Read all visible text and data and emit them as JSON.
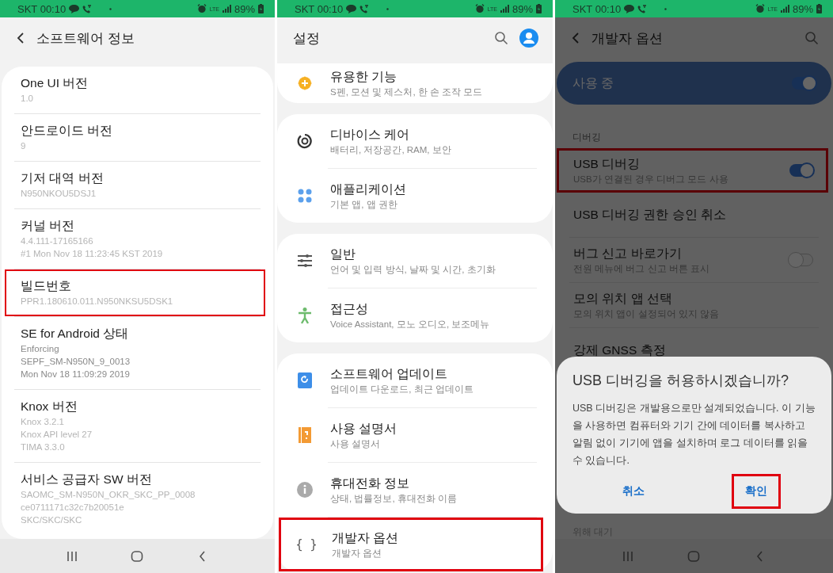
{
  "software_info": {
    "status_bar": {
      "carrier_time": "SKT 00:10",
      "network": "LTE",
      "battery": "89%"
    },
    "header": {
      "title": "소프트웨어 정보"
    },
    "items": [
      {
        "title": "One UI 버전",
        "lines": [
          "1.0"
        ],
        "blurred": true,
        "highlighted": false
      },
      {
        "title": "안드로이드 버전",
        "lines": [
          "9"
        ],
        "blurred": true,
        "highlighted": false
      },
      {
        "title": "기저 대역 버전",
        "lines": [
          "N950NKOU5DSJ1"
        ],
        "blurred": true,
        "highlighted": false
      },
      {
        "title": "커널 버전",
        "lines": [
          "4.4.111-17165166",
          "#1 Mon Nov 18 11:23:45 KST 2019"
        ],
        "blurred": true,
        "highlighted": false
      },
      {
        "title": "빌드번호",
        "lines": [
          "PPR1.180610.011.N950NKSU5DSK1"
        ],
        "blurred": true,
        "highlighted": true
      },
      {
        "title": "SE for Android 상태",
        "lines": [
          "Enforcing",
          "SEPF_SM-N950N_9_0013",
          "Mon Nov 18 11:09:29 2019"
        ],
        "blurred": false,
        "highlighted": false
      },
      {
        "title": "Knox 버전",
        "lines": [
          "Knox 3.2.1",
          "Knox API level 27",
          "TIMA 3.3.0"
        ],
        "blurred": true,
        "highlighted": false
      },
      {
        "title": "서비스 공급자 SW 버전",
        "lines": [
          "SAOMC_SM-N950N_OKR_SKC_PP_0008",
          "ce0711171c32c7b20051e",
          "SKC/SKC/SKC"
        ],
        "blurred": true,
        "highlighted": false
      }
    ]
  },
  "settings": {
    "status_bar": {
      "carrier_time": "SKT 00:10",
      "network": "LTE",
      "battery": "89%"
    },
    "header": {
      "title": "설정"
    },
    "cards": [
      {
        "items": [
          {
            "title": "유용한 기능",
            "subtitle": "S펜, 모션 및 제스처, 한 손 조작 모드",
            "highlighted": false
          }
        ]
      },
      {
        "items": [
          {
            "title": "디바이스 케어",
            "subtitle": "배터리, 저장공간, RAM, 보안",
            "highlighted": false
          },
          {
            "title": "애플리케이션",
            "subtitle": "기본 앱, 앱 권한",
            "highlighted": false
          }
        ]
      },
      {
        "items": [
          {
            "title": "일반",
            "subtitle": "언어 및 입력 방식, 날짜 및 시간, 초기화",
            "highlighted": false
          },
          {
            "title": "접근성",
            "subtitle": "Voice Assistant, 모노 오디오, 보조메뉴",
            "highlighted": false
          }
        ]
      },
      {
        "items": [
          {
            "title": "소프트웨어 업데이트",
            "subtitle": "업데이트 다운로드, 최근 업데이트",
            "highlighted": false
          },
          {
            "title": "사용 설명서",
            "subtitle": "사용 설명서",
            "highlighted": false
          },
          {
            "title": "휴대전화 정보",
            "subtitle": "상태, 법률정보, 휴대전화 이름",
            "highlighted": false
          },
          {
            "title": "개발자 옵션",
            "subtitle": "개발자 옵션",
            "glyph": "{ }",
            "highlighted": true
          }
        ]
      }
    ]
  },
  "developer_options": {
    "status_bar": {
      "carrier_time": "SKT 00:10",
      "network": "LTE",
      "battery": "89%"
    },
    "header": {
      "title": "개발자 옵션"
    },
    "master_switch": {
      "label": "사용 중",
      "on": true
    },
    "section": "디버깅",
    "items": [
      {
        "kind": "toggle",
        "title": "USB 디버깅",
        "subtitle": "USB가 연결된 경우 디버그 모드 사용",
        "on": true,
        "highlighted": true
      },
      {
        "kind": "plain",
        "title": "USB 디버깅 권한 승인 취소",
        "highlighted": false
      },
      {
        "kind": "toggle",
        "title": "버그 신고 바로가기",
        "subtitle": "전원 메뉴에 버그 신고 버튼 표시",
        "on": false,
        "highlighted": false
      },
      {
        "kind": "plain",
        "title": "모의 위치 앱 선택",
        "subtitle": "모의 위치 앱이 설정되어 있지 않음",
        "highlighted": false
      },
      {
        "kind": "plain",
        "title": "강제 GNSS 측정",
        "highlighted": false
      }
    ],
    "partial_text": "위해 대기",
    "dialog": {
      "title": "USB 디버깅을 허용하시겠습니까?",
      "body": "USB 디버깅은 개발용으로만 설계되었습니다. 이 기능을 사용하면 컴퓨터와 기기 간에 데이터를 복사하고 알림 없이 기기에 앱을 설치하며 로그 데이터를 읽을 수 있습니다.",
      "buttons": [
        {
          "label": "취소",
          "highlighted": false
        },
        {
          "label": "확인",
          "highlighted": true
        }
      ]
    }
  }
}
